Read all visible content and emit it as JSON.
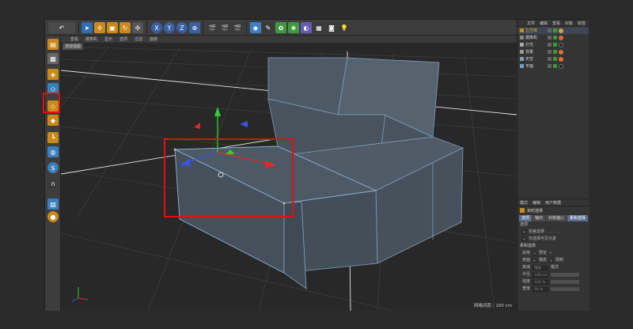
{
  "toolbar": {
    "undo": "↶",
    "axis_x": "X",
    "axis_y": "Y",
    "axis_z": "Z"
  },
  "viewport": {
    "menu": [
      "查看",
      "摄像机",
      "显示",
      "选项",
      "过滤",
      "面板"
    ],
    "label": "透视视图",
    "status": "网格间距 : 100 cm"
  },
  "object_manager": {
    "menu": [
      "文件",
      "编辑",
      "查看",
      "对象",
      "标签"
    ],
    "objects": [
      {
        "name": "立方体",
        "tag_color": "#d4a24a",
        "selected": true
      },
      {
        "name": "摄像机",
        "tag_color": "#d46a3a"
      },
      {
        "name": "灯光",
        "tag_color": "#222222"
      },
      {
        "name": "背景",
        "tag_color": "#e07030"
      },
      {
        "name": "天空",
        "tag_color": "#e07030"
      },
      {
        "name": "平面",
        "tag_color": "#222222"
      }
    ]
  },
  "attributes": {
    "menu": [
      "模式",
      "编辑",
      "用户数据"
    ],
    "title": "实时选择",
    "tabs": [
      "选项",
      "轴向",
      "对象轴心",
      "柔和选择"
    ],
    "section_options": "选项",
    "opt1": "容差选择 . . . . . .",
    "opt2": "仅选择可见元素",
    "section_soft": "柔和选择",
    "soft_enable": "启用",
    "soft_preview": "预览",
    "soft_surface": "表面",
    "soft_rubber": "橡皮",
    "soft_restrict": "限制",
    "falloff_label": "衰减",
    "falloff_value": "线性",
    "mode_label": "模式",
    "radius_label": "半径",
    "radius_value": "100 cm",
    "strength_label": "强度",
    "strength_value": "100 %",
    "width_label": "宽度",
    "width_value": "50 %"
  }
}
